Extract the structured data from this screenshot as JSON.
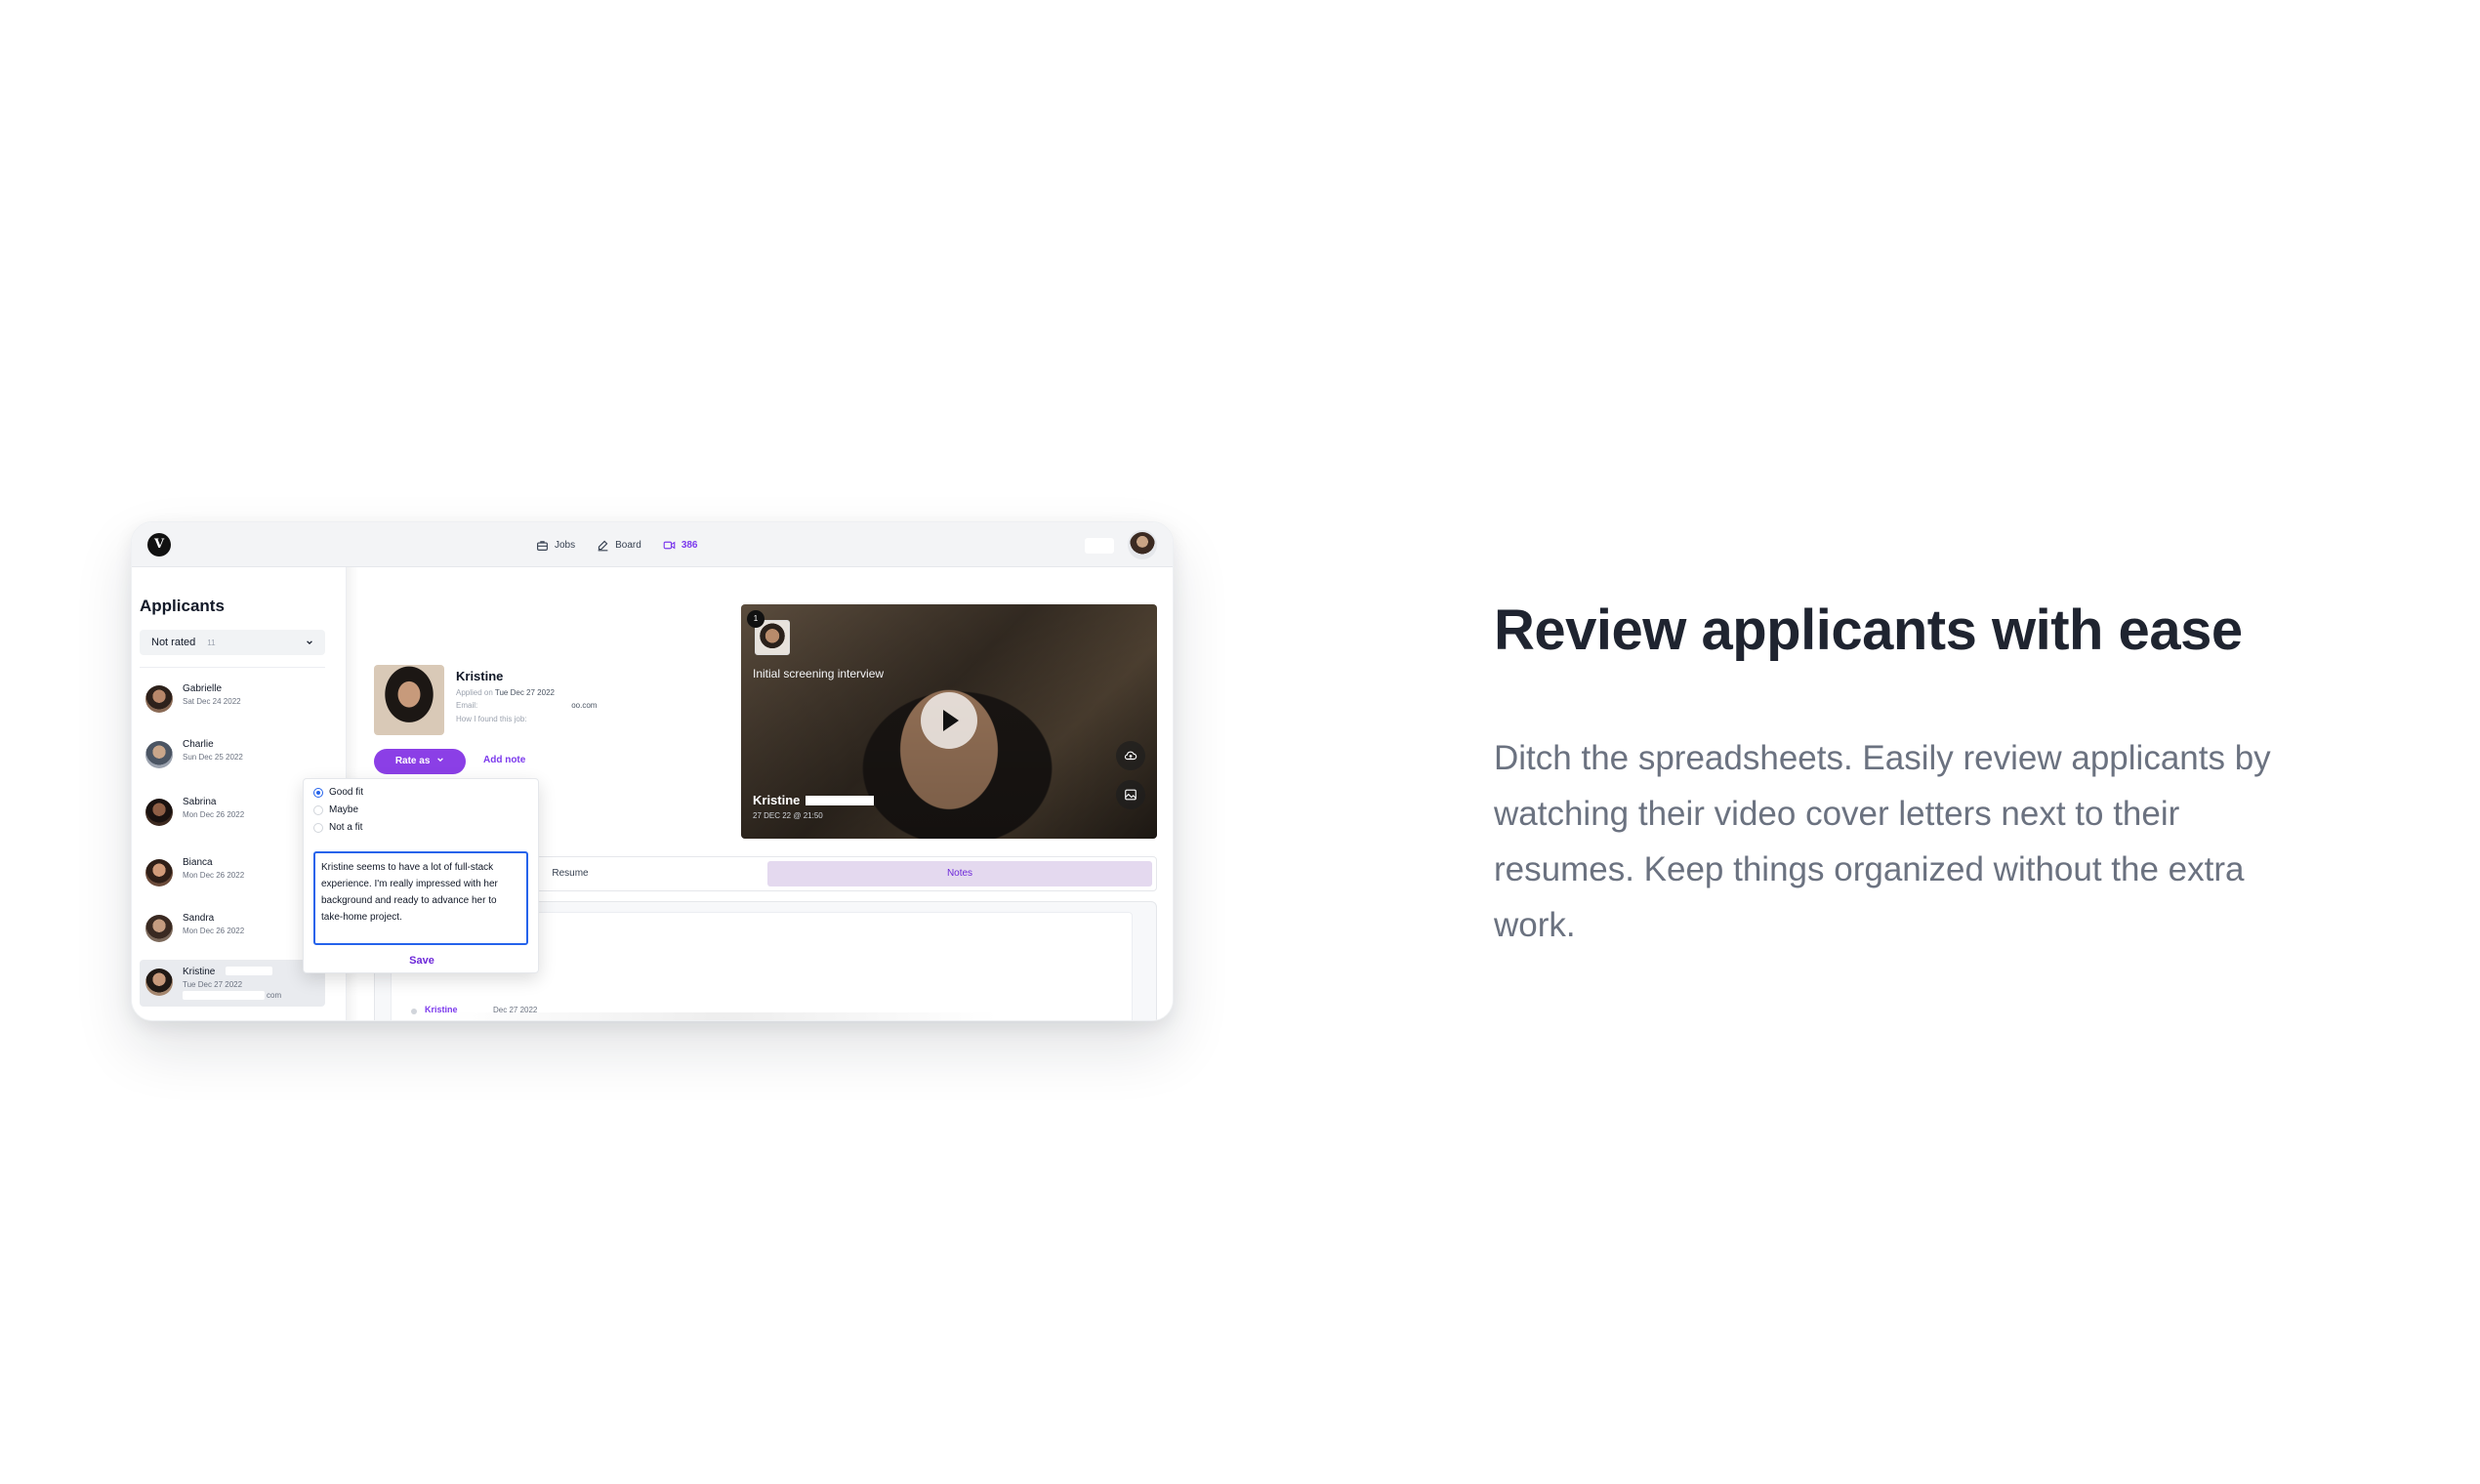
{
  "headline": "Review applicants with ease",
  "body": "Ditch the spreadsheets. Easily review applicants by watching their video cover letters next to their resumes. Keep things organized without the extra work.",
  "app": {
    "logo_letter": "V",
    "nav": [
      {
        "label": "Jobs",
        "icon": "briefcase-icon"
      },
      {
        "label": "Board",
        "icon": "edit-icon"
      },
      {
        "label": "386",
        "icon": "video-icon"
      }
    ],
    "sidebar": {
      "title": "Applicants",
      "filter": {
        "label": "Not rated",
        "count": "11"
      },
      "applicants": [
        {
          "name": "Gabrielle",
          "date": "Sat Dec 24 2022"
        },
        {
          "name": "Charlie",
          "date": "Sun Dec 25 2022"
        },
        {
          "name": "Sabrina",
          "date": "Mon Dec 26 2022"
        },
        {
          "name": "Bianca",
          "date": "Mon Dec 26 2022"
        },
        {
          "name": "Sandra",
          "date": "Mon Dec 26 2022"
        },
        {
          "name": "Kristine",
          "date": "Tue Dec 27 2022",
          "extra": "com"
        }
      ]
    },
    "profile": {
      "name": "Kristine",
      "applied_label": "Applied on",
      "applied_date": "Tue Dec 27 2022",
      "email_label": "Email:",
      "email_suffix": "oo.com",
      "found_label": "How I found this job:",
      "rate_button": "Rate as",
      "add_note": "Add note"
    },
    "video": {
      "badge": "1",
      "title": "Initial screening interview",
      "name": "Kristine",
      "date": "27 DEC 22 @ 21:50"
    },
    "tabs": {
      "resume": "Resume",
      "notes": "Notes"
    },
    "notes": {
      "author": "Kristine",
      "date": "Dec 27 2022"
    },
    "rating": {
      "options": [
        "Good fit",
        "Maybe",
        "Not a fit"
      ],
      "selected": "Good fit",
      "note_text": "Kristine seems to have a lot of full-stack experience. I'm really impressed with her background and ready to advance her to take-home project.",
      "save": "Save"
    }
  },
  "colors": {
    "accent": "#8b3fe6",
    "heading": "#1f2430",
    "body": "#6b7280",
    "focus": "#2563eb"
  }
}
